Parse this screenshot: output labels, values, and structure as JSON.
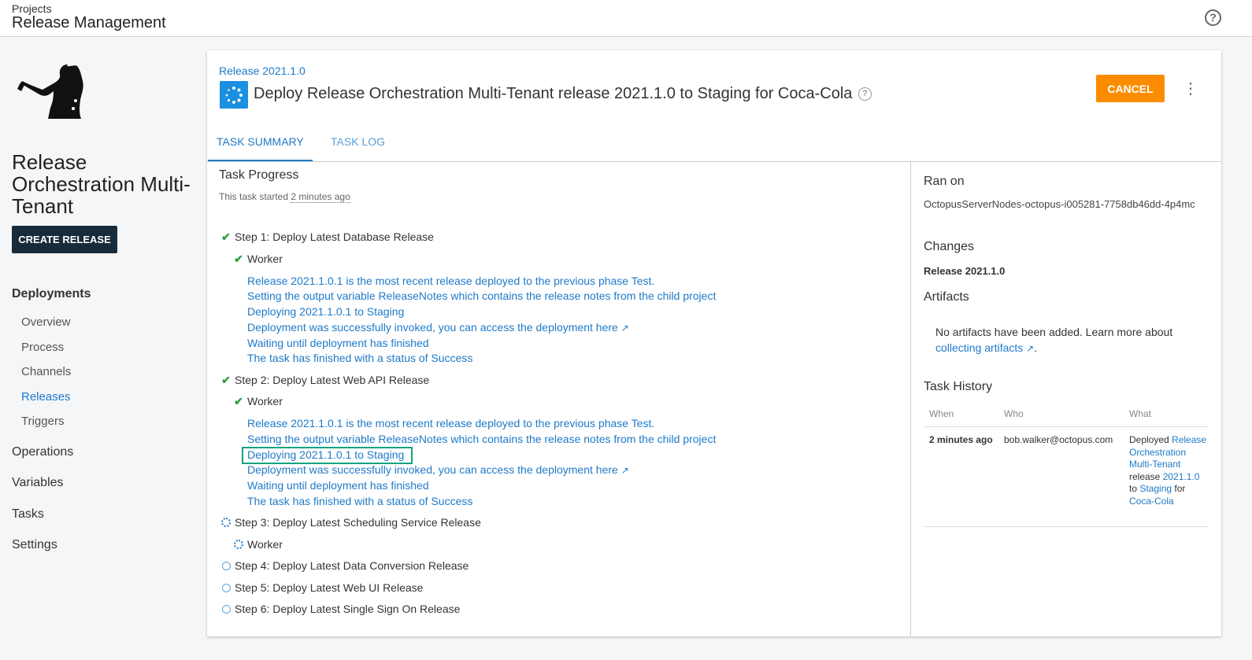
{
  "header": {
    "breadcrumb": "Projects",
    "title": "Release Management",
    "help_icon": "question-circle-icon"
  },
  "sidebar": {
    "project_name": "Release Orchestration Multi-Tenant",
    "create_release_label": "CREATE RELEASE",
    "deployments_label": "Deployments",
    "deployments_items": [
      {
        "label": "Overview",
        "active": false
      },
      {
        "label": "Process",
        "active": false
      },
      {
        "label": "Channels",
        "active": false
      },
      {
        "label": "Releases",
        "active": true
      },
      {
        "label": "Triggers",
        "active": false
      }
    ],
    "sections": [
      "Operations",
      "Variables",
      "Tasks",
      "Settings"
    ]
  },
  "task": {
    "release_link": "Release 2021.1.0",
    "title": "Deploy Release Orchestration Multi-Tenant release 2021.1.0 to Staging for Coca-Cola",
    "cancel_label": "CANCEL",
    "tabs": [
      "TASK SUMMARY",
      "TASK LOG"
    ]
  },
  "progress": {
    "heading": "Task Progress",
    "started_prefix": "This task started ",
    "started_ago": "2 minutes ago",
    "steps": [
      {
        "label": "Step 1: Deploy Latest Database Release",
        "status": "success"
      },
      {
        "label": "Step 2: Deploy Latest Web API Release",
        "status": "success"
      },
      {
        "label": "Step 3: Deploy Latest Scheduling Service Release",
        "status": "running"
      },
      {
        "label": "Step 4: Deploy Latest Data Conversion Release",
        "status": "pending"
      },
      {
        "label": "Step 5: Deploy Latest Web UI Release",
        "status": "pending"
      },
      {
        "label": "Step 6: Deploy Latest Single Sign On Release",
        "status": "pending"
      }
    ],
    "worker_label": "Worker",
    "logs": [
      "Release 2021.1.0.1 is the most recent release deployed to the previous phase Test.",
      "Setting the output variable ReleaseNotes which contains the release notes from the child project",
      "Deploying 2021.1.0.1 to Staging",
      "Deployment was successfully invoked, you can access the deployment ",
      "Waiting until deployment has finished",
      "The task has finished with a status of Success"
    ],
    "here_link": "here"
  },
  "right_panel": {
    "ran_on_heading": "Ran on",
    "ran_on_value": "OctopusServerNodes-octopus-i005281-7758db46dd-4p4mc",
    "changes_heading": "Changes",
    "changes_value": "Release 2021.1.0",
    "artifacts_heading": "Artifacts",
    "artifacts_text": "No artifacts have been added. Learn more about ",
    "artifacts_link": "collecting artifacts",
    "history_heading": "Task History",
    "history_columns": [
      "When",
      "Who",
      "What"
    ],
    "history_row": {
      "when": "2 minutes ago",
      "who": "bob.walker@octopus.com",
      "what_prefix": "Deployed ",
      "what_project": "Release Orchestration Multi-Tenant",
      "what_release_word": " release ",
      "what_version": "2021.1.0",
      "what_to": " to ",
      "what_env": "Staging",
      "what_for": " for ",
      "what_tenant": "Coca-Cola"
    }
  },
  "colors": {
    "primary": "#1f7ac8",
    "cancel": "#fb8c00",
    "create_button": "#172b3a",
    "success": "#2e9e3f",
    "highlight": "#15a382"
  }
}
